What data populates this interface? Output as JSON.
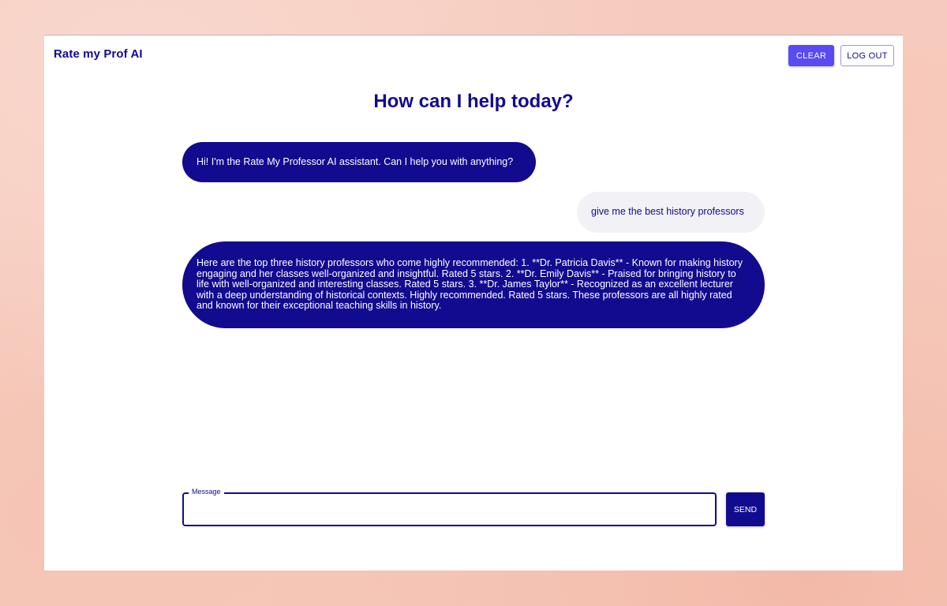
{
  "header": {
    "brand": "Rate my Prof AI",
    "clear_label": "CLEAR",
    "logout_label": "LOG OUT"
  },
  "main": {
    "headline": "How can I help today?"
  },
  "messages": [
    {
      "role": "assistant",
      "text": "Hi! I'm the Rate My Professor AI assistant. Can I help you with anything?"
    },
    {
      "role": "user",
      "text": "give me the best history professors"
    },
    {
      "role": "assistant",
      "text": "Here are the top three history professors who come highly recommended: 1. **Dr. Patricia Davis** - Known for making history engaging and her classes well-organized and insightful. Rated 5 stars. 2. **Dr. Emily Davis** - Praised for bringing history to life with well-organized and interesting classes. Rated 5 stars. 3. **Dr. James Taylor** - Recognized as an excellent lecturer with a deep understanding of historical contexts. Highly recommended. Rated 5 stars. These professors are all highly rated and known for their exceptional teaching skills in history."
    }
  ],
  "composer": {
    "label": "Message",
    "value": "",
    "send_label": "SEND"
  },
  "colors": {
    "primary": "#120a8f",
    "accent": "#5a4af2",
    "user_bubble": "#f2f1f6",
    "background": "#f6cdbf"
  }
}
